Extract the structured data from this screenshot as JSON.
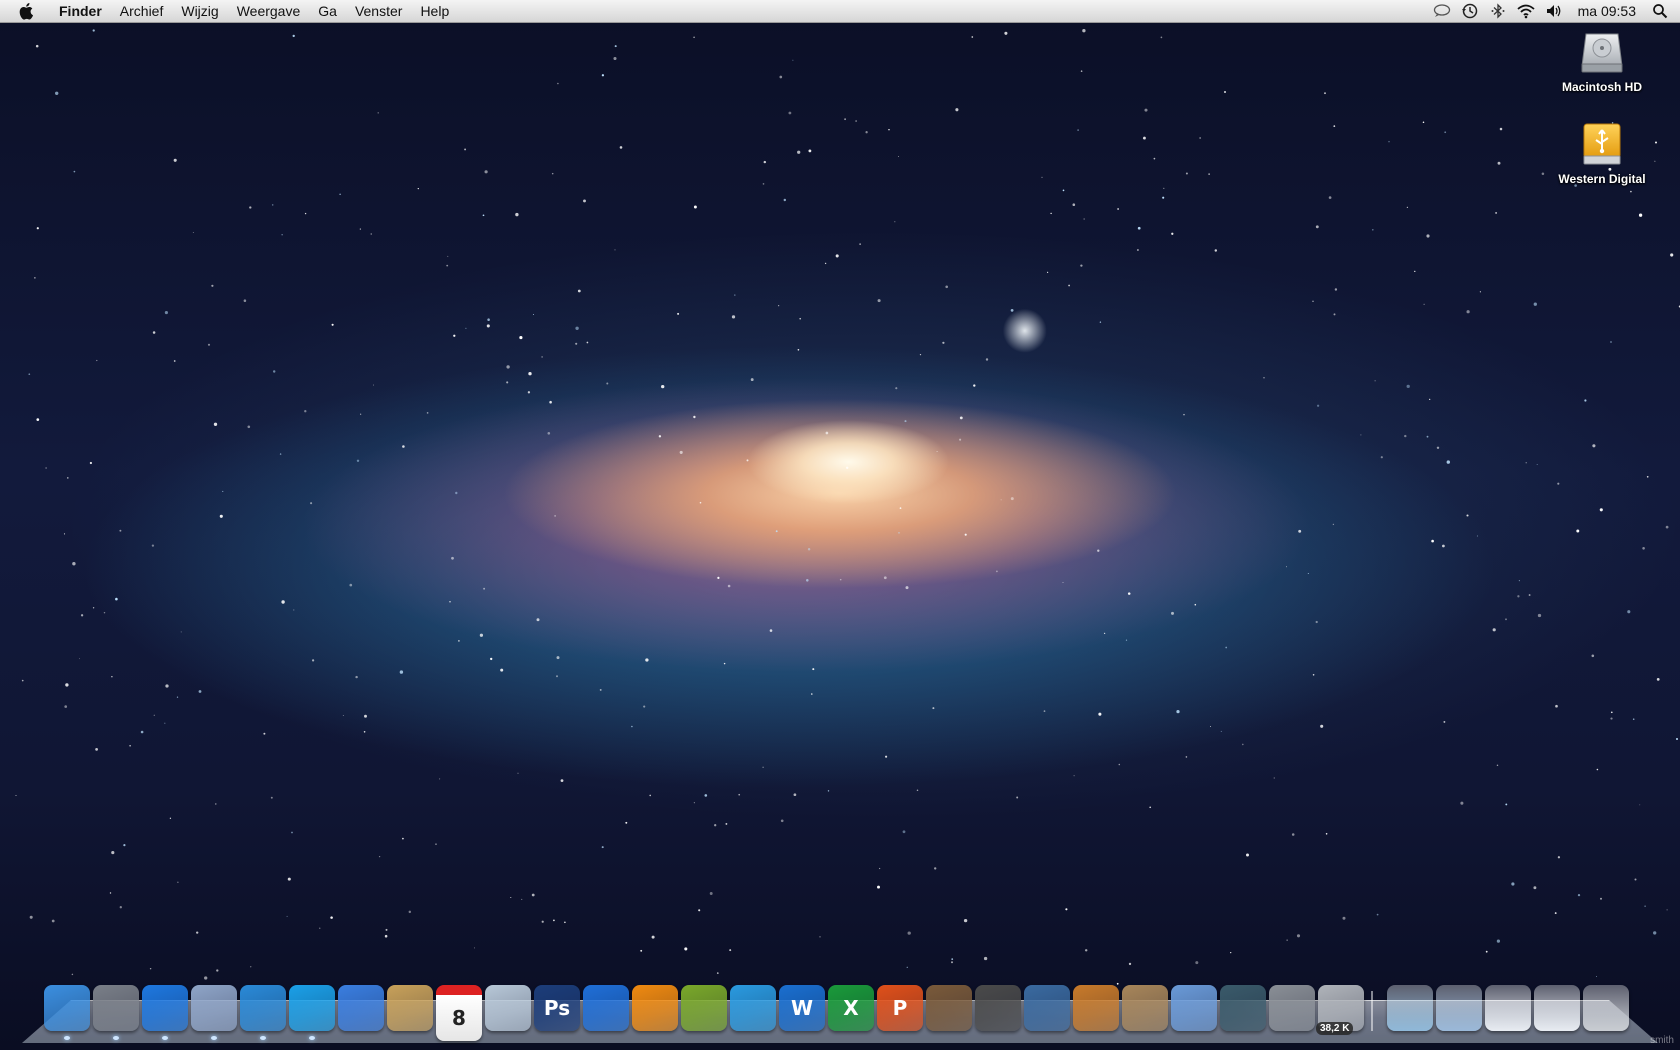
{
  "menubar": {
    "app_name": "Finder",
    "items": [
      "Archief",
      "Wijzig",
      "Weergave",
      "Ga",
      "Venster",
      "Help"
    ],
    "clock": "ma 09:53",
    "status_icons": [
      "speech-bubble-icon",
      "time-machine-icon",
      "bluetooth-icon",
      "wifi-icon",
      "volume-icon",
      "spotlight-search-icon"
    ]
  },
  "desktop": {
    "wallpaper": "galaxy",
    "icons": [
      {
        "label": "Macintosh HD",
        "icon": "hard-drive-icon"
      },
      {
        "label": "Western Digital",
        "icon": "usb-drive-icon"
      }
    ]
  },
  "dock": {
    "apps": [
      {
        "name": "finder",
        "color": "#3b8fe0"
      },
      {
        "name": "launchpad",
        "color": "#7a7f88"
      },
      {
        "name": "app-store",
        "color": "#1e78e0"
      },
      {
        "name": "mail",
        "color": "#8fa5c8"
      },
      {
        "name": "safari",
        "color": "#2a8ad8"
      },
      {
        "name": "skype",
        "color": "#1ba0e8"
      },
      {
        "name": "ichat",
        "color": "#3a7ee0"
      },
      {
        "name": "address-book",
        "color": "#c8a15a"
      },
      {
        "name": "ical",
        "color": "#ffffff",
        "text": "8"
      },
      {
        "name": "preview",
        "color": "#b8c8d8"
      },
      {
        "name": "photoshop",
        "color": "#1c3d7a",
        "text": "Ps"
      },
      {
        "name": "itunes",
        "color": "#1f6fd8"
      },
      {
        "name": "vlc",
        "color": "#f08a10"
      },
      {
        "name": "adium",
        "color": "#7aa82a"
      },
      {
        "name": "msn-messenger",
        "color": "#2a9ae0"
      },
      {
        "name": "word",
        "color": "#1a6fd0",
        "text": "W"
      },
      {
        "name": "excel",
        "color": "#1a9a3a",
        "text": "X"
      },
      {
        "name": "powerpoint",
        "color": "#e0501a",
        "text": "P"
      },
      {
        "name": "iphoto",
        "color": "#7a5a3a"
      },
      {
        "name": "imovie",
        "color": "#4a4a4a"
      },
      {
        "name": "dvd-player",
        "color": "#3a6aa0"
      },
      {
        "name": "garageband",
        "color": "#c87a2a"
      },
      {
        "name": "iphoto-library",
        "color": "#a8865a"
      },
      {
        "name": "itunes-folder",
        "color": "#6a9ad8"
      },
      {
        "name": "time-machine",
        "color": "#3a5a6a"
      },
      {
        "name": "system-preferences",
        "color": "#8a8f96"
      },
      {
        "name": "activity-monitor",
        "color": "#b0b4ba",
        "badge": "38,2 K"
      }
    ],
    "stacks": [
      {
        "name": "downloads-stack",
        "color": "#8fb8d8"
      },
      {
        "name": "applications-stack",
        "color": "#9ab8d8"
      },
      {
        "name": "screenshot-stack-1",
        "color": "#e8ecf2"
      },
      {
        "name": "screenshot-stack-2",
        "color": "#e8ecf2"
      },
      {
        "name": "trash",
        "color": "#c8ccd2"
      }
    ]
  },
  "watermark": "smith"
}
